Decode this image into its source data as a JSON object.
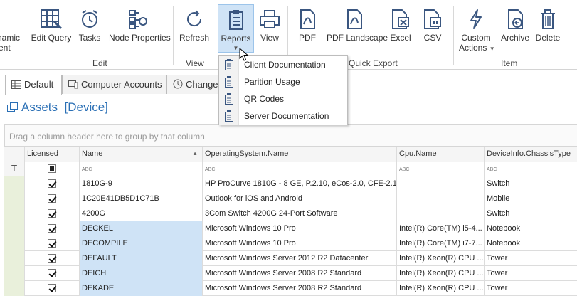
{
  "ribbon": {
    "buttons": {
      "dynamic": "namic",
      "dynamic2": "ent",
      "edit_query": "Edit Query",
      "tasks": "Tasks",
      "node_properties": "Node Properties",
      "refresh": "Refresh",
      "reports": "Reports",
      "view": "View",
      "pdf": "PDF",
      "pdf_landscape": "PDF Landscape",
      "excel": "Excel",
      "csv": "CSV",
      "custom_actions_1": "Custom",
      "custom_actions_2": "Actions",
      "archive": "Archive",
      "delete": "Delete"
    },
    "groups": {
      "edit": "Edit",
      "view": "View",
      "quick_export": "Quick Export",
      "item": "Item"
    }
  },
  "reports_menu": {
    "items": [
      "Client Documentation",
      "Parition Usage",
      "QR Codes",
      "Server Documentation"
    ]
  },
  "tabs": [
    "Default",
    "Computer Accounts",
    "Changes"
  ],
  "title": {
    "main": "Assets",
    "sub": "[Device]"
  },
  "grid": {
    "group_panel_text": "Drag a column header here to group by that column",
    "columns": [
      "Licensed",
      "Name",
      "OperatingSystem.Name",
      "Cpu.Name",
      "DeviceInfo.ChassisType"
    ],
    "filter_icon": "ABC",
    "rows": [
      {
        "licensed": true,
        "name": "1810G-9",
        "os": "HP ProCurve 1810G - 8 GE, P.2.10, eCos-2.0, CFE-2.1",
        "cpu": "",
        "chassis": "Switch"
      },
      {
        "licensed": true,
        "name": "1C20E41DB5D1C71B",
        "os": "Outlook for iOS and Android",
        "cpu": "",
        "chassis": "Mobile"
      },
      {
        "licensed": true,
        "name": "4200G",
        "os": "3Com Switch 4200G 24-Port Software",
        "cpu": "",
        "chassis": "Switch"
      },
      {
        "licensed": true,
        "name": "DECKEL",
        "os": "Microsoft Windows 10 Pro",
        "cpu": "Intel(R) Core(TM) i5-4...",
        "chassis": "Notebook"
      },
      {
        "licensed": true,
        "name": "DECOMPILE",
        "os": "Microsoft Windows 10 Pro",
        "cpu": "Intel(R) Core(TM) i7-7...",
        "chassis": "Notebook"
      },
      {
        "licensed": true,
        "name": "DEFAULT",
        "os": "Microsoft Windows Server 2012 R2 Datacenter",
        "cpu": "Intel(R) Xeon(R) CPU ...",
        "chassis": "Tower"
      },
      {
        "licensed": true,
        "name": "DEICH",
        "os": "Microsoft Windows Server 2008 R2 Standard",
        "cpu": "Intel(R) Xeon(R) CPU ...",
        "chassis": "Tower"
      },
      {
        "licensed": true,
        "name": "DEKADE",
        "os": "Microsoft Windows Server 2008 R2 Standard",
        "cpu": "Intel(R) Xeon(R) CPU ...",
        "chassis": "Tower"
      }
    ]
  },
  "colors": {
    "accent": "#2a6fb5",
    "selection": "#cfe3f6",
    "indicator": "#e9f0db"
  }
}
